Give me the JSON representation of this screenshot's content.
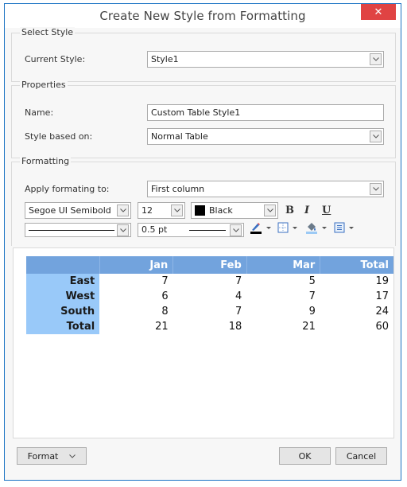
{
  "window": {
    "title": "Create New Style from Formatting",
    "close_icon": "close-icon"
  },
  "select_style": {
    "legend": "Select Style",
    "current_style_label": "Current Style:",
    "current_style_value": "Style1"
  },
  "properties": {
    "legend": "Properties",
    "name_label": "Name:",
    "name_value": "Custom Table Style1",
    "based_on_label": "Style based on:",
    "based_on_value": "Normal Table"
  },
  "formatting": {
    "legend": "Formatting",
    "apply_label": "Apply formating to:",
    "apply_value": "First column",
    "font_family": "Segoe UI Semibold",
    "font_size": "12",
    "font_color_name": "Black",
    "font_color_hex": "#000000",
    "bold_label": "B",
    "italic_label": "I",
    "underline_label": "U",
    "border_width": "0.5 pt",
    "icons": [
      "pen-color-icon",
      "borders-icon",
      "shading-icon",
      "alignment-icon"
    ]
  },
  "preview": {
    "columns": [
      "",
      "Jan",
      "Feb",
      "Mar",
      "Total"
    ],
    "rows": [
      {
        "label": "East",
        "values": [
          "7",
          "7",
          "5",
          "19"
        ]
      },
      {
        "label": "West",
        "values": [
          "6",
          "4",
          "7",
          "17"
        ]
      },
      {
        "label": "South",
        "values": [
          "8",
          "7",
          "9",
          "24"
        ]
      },
      {
        "label": "Total",
        "values": [
          "21",
          "18",
          "21",
          "60"
        ]
      }
    ],
    "header_color": "#72a3dd",
    "first_column_color": "#99c9f9"
  },
  "footer": {
    "format_label": "Format",
    "ok_label": "OK",
    "cancel_label": "Cancel"
  }
}
